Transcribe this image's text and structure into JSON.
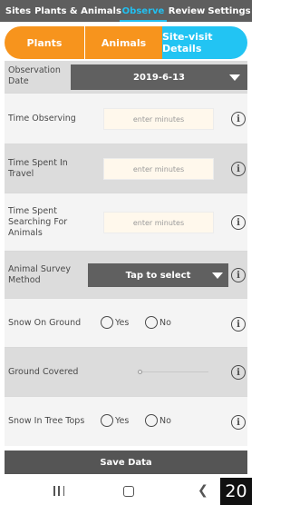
{
  "top_nav": {
    "tabs": [
      "Sites",
      "Plants & Animals",
      "Observe",
      "Review",
      "Settings"
    ],
    "active": "Observe",
    "accent_color": "#22bff0"
  },
  "segments": {
    "plants": "Plants",
    "animals": "Animals",
    "site_visit": "Site-visit Details",
    "orange": "#f7941d",
    "blue": "#22c4f3"
  },
  "form": {
    "observation_date": {
      "label_line1": "Observation",
      "label_line2": "Date",
      "value": "2019-6-13"
    },
    "time_observing": {
      "label": "Time Observing",
      "placeholder": "enter minutes"
    },
    "time_travel": {
      "label_line1": "Time Spent In",
      "label_line2": "Travel",
      "placeholder": "enter minutes"
    },
    "time_searching": {
      "label_line1": "Time Spent",
      "label_line2": "Searching For",
      "label_line3": "Animals",
      "placeholder": "enter minutes"
    },
    "survey_method": {
      "label_line1": "Animal Survey",
      "label_line2": "Method",
      "value": "Tap to select"
    },
    "snow_ground": {
      "label": "Snow On Ground",
      "yes": "Yes",
      "no": "No"
    },
    "ground_covered": {
      "label": "Ground Covered",
      "value_fraction": 0
    },
    "snow_trees": {
      "label": "Snow In Tree Tops",
      "yes": "Yes",
      "no": "No"
    },
    "info_glyph": "i"
  },
  "save_label": "Save Data",
  "badge": "20"
}
